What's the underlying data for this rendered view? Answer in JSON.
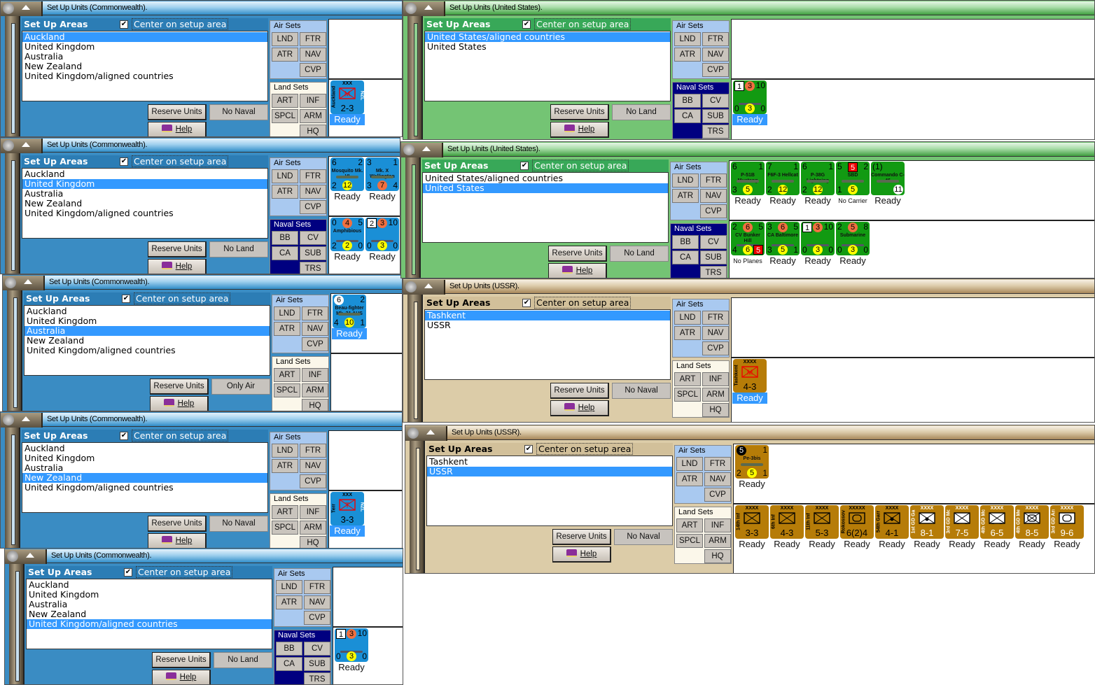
{
  "windows": [
    {
      "title": "Set Up Units (Commonwealth).",
      "header": "Set Up Areas",
      "center_label": "Center on setup area",
      "center_checked": true,
      "areas": [
        "Auckland",
        "United Kingdom",
        "Australia",
        "New Zealand",
        "United Kingdom/aligned countries"
      ],
      "selected_index": 0,
      "reserve_label": "Reserve Units",
      "filter_label": "No Naval",
      "help_label": "Help",
      "panels": [
        {
          "kind": "air",
          "title": "Air Sets",
          "buttons": [
            "LND",
            "FTR",
            "ATR",
            "NAV",
            "CVP"
          ],
          "counters": []
        },
        {
          "kind": "land",
          "title": "Land Sets",
          "buttons": [
            "ART",
            "INF",
            "SPCL",
            "ARM",
            "HQ"
          ],
          "counters": [
            {
              "type": "land",
              "echelon": "XXX",
              "name": "Auckland",
              "side": "NZL",
              "symbol": "M",
              "symbol_kind": "mountain",
              "strength": "2-3",
              "status": "Ready",
              "selected": true
            }
          ]
        }
      ]
    },
    {
      "title": "Set Up Units (Commonwealth).",
      "header": "Set Up Areas",
      "center_label": "Center on setup area",
      "center_checked": true,
      "areas": [
        "Auckland",
        "United Kingdom",
        "Australia",
        "New Zealand",
        "United Kingdom/aligned countries"
      ],
      "selected_index": 1,
      "reserve_label": "Reserve Units",
      "filter_label": "No Land",
      "help_label": "Help",
      "panels": [
        {
          "kind": "air",
          "title": "Air Sets",
          "buttons": [
            "LND",
            "FTR",
            "ATR",
            "NAV",
            "CVP"
          ],
          "counters": [
            {
              "type": "air",
              "tl": "6",
              "tr": "2",
              "name": "Mosquito Mk. VI",
              "bl": "2",
              "bc": {
                "v": "12",
                "c": "yellow"
              },
              "status": "Ready"
            },
            {
              "type": "air",
              "tl": "3",
              "tr": "1",
              "name": "Mk. X Wellington",
              "bc": {
                "v": "7",
                "c": "orange"
              },
              "bl": "3",
              "br": "4",
              "status": "Ready"
            }
          ]
        },
        {
          "kind": "naval",
          "title": "Naval Sets",
          "buttons": [
            "BB",
            "CV",
            "CA",
            "SUB",
            "TRS"
          ],
          "counters": [
            {
              "type": "naval",
              "tl": "0",
              "tc": {
                "v": "4",
                "c": "orange"
              },
              "tr": "5",
              "name": "Amphibious",
              "bl": "2",
              "bc": {
                "v": "2",
                "c": "yellow"
              },
              "br": "0",
              "status": "Ready"
            },
            {
              "type": "naval",
              "tl": {
                "v": "2",
                "c": "box"
              },
              "tc": {
                "v": "3",
                "c": "orange"
              },
              "tr": "10",
              "name": "",
              "bl": "0",
              "bc": {
                "v": "3",
                "c": "yellow"
              },
              "br": "0",
              "status": "Ready"
            }
          ]
        }
      ]
    },
    {
      "title": "Set Up Units (Commonwealth).",
      "header": "Set Up Areas",
      "center_label": "Center on setup area",
      "center_checked": true,
      "areas": [
        "Auckland",
        "United Kingdom",
        "Australia",
        "New Zealand",
        "United Kingdom/aligned countries"
      ],
      "selected_index": 2,
      "reserve_label": "Reserve Units",
      "filter_label": "Only Air",
      "help_label": "Help",
      "panels": [
        {
          "kind": "air",
          "title": "Air Sets",
          "buttons": [
            "LND",
            "FTR",
            "ATR",
            "NAV",
            "CVP"
          ],
          "counters": [
            {
              "type": "air",
              "tl": {
                "v": "6",
                "c": "white"
              },
              "tr": "2",
              "name": "Beau-fighter Mk. 21 AUS",
              "bl": "4",
              "bc": {
                "v": "10",
                "c": "yellow"
              },
              "br": "1",
              "status": "Ready",
              "selected": true
            }
          ]
        },
        {
          "kind": "land",
          "title": "Land Sets",
          "buttons": [
            "ART",
            "INF",
            "SPCL",
            "ARM",
            "HQ"
          ],
          "counters": []
        }
      ]
    },
    {
      "title": "Set Up Units (Commonwealth).",
      "header": "Set Up Areas",
      "center_label": "Center on setup area",
      "center_checked": true,
      "areas": [
        "Auckland",
        "United Kingdom",
        "Australia",
        "New Zealand",
        "United Kingdom/aligned countries"
      ],
      "selected_index": 3,
      "reserve_label": "Reserve Units",
      "filter_label": "No Naval",
      "help_label": "Help",
      "panels": [
        {
          "kind": "air",
          "title": "Air Sets",
          "buttons": [
            "LND",
            "FTR",
            "ATR",
            "NAV",
            "CVP"
          ],
          "counters": []
        },
        {
          "kind": "land",
          "title": "Land Sets",
          "buttons": [
            "ART",
            "INF",
            "SPCL",
            "ARM",
            "HQ"
          ],
          "counters": [
            {
              "type": "land",
              "echelon": "XXX",
              "name": "Terr",
              "side": "NZL",
              "symbol": "T",
              "symbol_kind": "mountain",
              "strength": "3-3",
              "status": "Ready",
              "selected": true
            }
          ]
        }
      ]
    },
    {
      "title": "Set Up Units (Commonwealth).",
      "header": "Set Up Areas",
      "center_label": "Center on setup area",
      "center_checked": true,
      "areas": [
        "Auckland",
        "United Kingdom",
        "Australia",
        "New Zealand",
        "United Kingdom/aligned countries"
      ],
      "selected_index": 4,
      "reserve_label": "Reserve Units",
      "filter_label": "No Land",
      "help_label": "Help",
      "panels": [
        {
          "kind": "air",
          "title": "Air Sets",
          "buttons": [
            "LND",
            "FTR",
            "ATR",
            "NAV",
            "CVP"
          ],
          "counters": []
        },
        {
          "kind": "naval",
          "title": "Naval Sets",
          "buttons": [
            "BB",
            "CV",
            "CA",
            "SUB",
            "TRS"
          ],
          "counters": [
            {
              "type": "naval",
              "tl": {
                "v": "1",
                "c": "box"
              },
              "tc": {
                "v": "3",
                "c": "orange"
              },
              "tr": "10",
              "name": "",
              "bl": "0",
              "bc": {
                "v": "3",
                "c": "yellow"
              },
              "br": "0",
              "status": "Ready"
            }
          ]
        }
      ]
    },
    {
      "title": "Set Up Units (United States).",
      "header": "Set Up Areas",
      "center_label": "Center on setup area",
      "center_checked": true,
      "areas": [
        "United States/aligned countries",
        "United States"
      ],
      "selected_index": 0,
      "reserve_label": "Reserve Units",
      "filter_label": "No Land",
      "help_label": "Help",
      "panels": [
        {
          "kind": "air",
          "title": "Air Sets",
          "buttons": [
            "LND",
            "FTR",
            "ATR",
            "NAV",
            "CVP"
          ],
          "counters": []
        },
        {
          "kind": "naval",
          "title": "Naval Sets",
          "buttons": [
            "BB",
            "CV",
            "CA",
            "SUB",
            "TRS"
          ],
          "counters": [
            {
              "type": "naval",
              "tl": {
                "v": "1",
                "c": "box"
              },
              "tc": {
                "v": "3",
                "c": "orange"
              },
              "tr": "10",
              "name": "",
              "bl": "0",
              "bc": {
                "v": "3",
                "c": "yellow"
              },
              "br": "0",
              "status": "Ready",
              "selected": true
            }
          ]
        }
      ]
    },
    {
      "title": "Set Up Units (United States).",
      "header": "Set Up Areas",
      "center_label": "Center on setup area",
      "center_checked": true,
      "areas": [
        "United States/aligned countries",
        "United States"
      ],
      "selected_index": 1,
      "reserve_label": "Reserve Units",
      "filter_label": "No Land",
      "help_label": "Help",
      "panels": [
        {
          "kind": "air",
          "title": "Air Sets",
          "buttons": [
            "LND",
            "FTR",
            "ATR",
            "NAV",
            "CVP"
          ],
          "counters": [
            {
              "type": "air",
              "tl": "6",
              "tr": "1",
              "name": "P-51B Mustang",
              "bl": "3",
              "bc": {
                "v": "5",
                "c": "yellow"
              },
              "status": "Ready"
            },
            {
              "type": "air",
              "tl": "7",
              "tr": "1",
              "name": "F6F-3 Hellcat",
              "bl": "2",
              "bc": {
                "v": "12",
                "c": "yellow"
              },
              "status": "Ready"
            },
            {
              "type": "air",
              "tl": "6",
              "tr": "1",
              "name": "P-38G Lightning",
              "bl": "2",
              "bc": {
                "v": "12",
                "c": "yellow"
              },
              "status": "Ready"
            },
            {
              "type": "air",
              "tl": "5",
              "tc": {
                "v": "5",
                "c": "red"
              },
              "tr": "2",
              "name": "SBD",
              "bl": "1",
              "bc": {
                "v": "5",
                "c": "yellow"
              },
              "status": "No Carrier"
            },
            {
              "type": "air",
              "tl": "(1)",
              "name": "Commando C-46",
              "br": {
                "v": "11",
                "c": "white"
              },
              "status": "Ready"
            }
          ]
        },
        {
          "kind": "naval",
          "title": "Naval Sets",
          "buttons": [
            "BB",
            "CV",
            "CA",
            "SUB",
            "TRS"
          ],
          "counters": [
            {
              "type": "naval",
              "tl": "2",
              "tc": {
                "v": "6",
                "c": "orange"
              },
              "tr": "5",
              "name": "CV Bunker Hill",
              "bl": "4",
              "bc": {
                "v": "6",
                "c": "yellow"
              },
              "br": {
                "v": "5",
                "c": "red"
              },
              "status": "No Planes"
            },
            {
              "type": "naval",
              "tl": "3",
              "tc": {
                "v": "6",
                "c": "orange"
              },
              "tr": "5",
              "name": "CA Baltimore",
              "bl": "3",
              "bc": {
                "v": "5",
                "c": "yellow"
              },
              "br": "1",
              "status": "Ready"
            },
            {
              "type": "naval",
              "tl": {
                "v": "1",
                "c": "box"
              },
              "tc": {
                "v": "3",
                "c": "orange"
              },
              "tr": "10",
              "name": "",
              "bl": "0",
              "bc": {
                "v": "3",
                "c": "yellow"
              },
              "br": "0",
              "status": "Ready"
            },
            {
              "type": "naval",
              "tl": "2",
              "tc": {
                "v": "5",
                "c": "orange"
              },
              "tr": "8",
              "name": "Submarine",
              "bl": "0",
              "bc": {
                "v": "3",
                "c": "yellow"
              },
              "br": "0",
              "status": "Ready"
            }
          ]
        }
      ]
    },
    {
      "title": "Set Up Units (USSR).",
      "header": "Set Up Areas",
      "center_label": "Center on setup area",
      "center_checked": true,
      "areas": [
        "Tashkent",
        "USSR"
      ],
      "selected_index": 0,
      "reserve_label": "Reserve Units",
      "filter_label": "No Naval",
      "help_label": "Help",
      "panels": [
        {
          "kind": "air",
          "title": "Air Sets",
          "buttons": [
            "LND",
            "FTR",
            "ATR",
            "NAV",
            "CVP"
          ],
          "counters": []
        },
        {
          "kind": "land",
          "title": "Land Sets",
          "buttons": [
            "ART",
            "INF",
            "SPCL",
            "ARM",
            "HQ"
          ],
          "counters": [
            {
              "type": "land",
              "echelon": "XXXX",
              "name": "Tashkent",
              "symbol": "M",
              "symbol_kind": "mountain",
              "strength": "4-3",
              "status": "Ready",
              "selected": true
            }
          ]
        }
      ]
    },
    {
      "title": "Set Up Units (USSR).",
      "header": "Set Up Areas",
      "center_label": "Center on setup area",
      "center_checked": true,
      "areas": [
        "Tashkent",
        "USSR"
      ],
      "selected_index": 1,
      "reserve_label": "Reserve Units",
      "filter_label": "No Naval",
      "help_label": "Help",
      "panels": [
        {
          "kind": "air",
          "title": "Air Sets",
          "buttons": [
            "LND",
            "FTR",
            "ATR",
            "NAV",
            "CVP"
          ],
          "counters": [
            {
              "type": "air",
              "tl": {
                "v": "5",
                "c": "black"
              },
              "tr": "1",
              "name": "Pe-3bis",
              "bl": "2",
              "bc": {
                "v": "5",
                "c": "yellow"
              },
              "br": "1",
              "status": "Ready"
            }
          ]
        },
        {
          "kind": "land",
          "title": "Land Sets",
          "buttons": [
            "ART",
            "INF",
            "SPCL",
            "ARM",
            "HQ"
          ],
          "counters": [
            {
              "type": "land",
              "echelon": "XXXX",
              "name": "14th Inf",
              "symbol_kind": "inf",
              "strength": "3-3",
              "status": "Ready"
            },
            {
              "type": "land",
              "echelon": "XXXX",
              "name": "6th Inf",
              "symbol_kind": "inf",
              "strength": "4-3",
              "status": "Ready"
            },
            {
              "type": "land",
              "echelon": "XXXX",
              "name": "11th Inf",
              "symbol_kind": "inf",
              "strength": "5-3",
              "status": "Ready"
            },
            {
              "type": "land",
              "echelon": "XXXXX",
              "name": "Rokossovs.",
              "symbol_kind": "armor",
              "strength": "6(2)4",
              "status": "Ready"
            },
            {
              "type": "land",
              "echelon": "XXXX",
              "name": "54th Garr",
              "symbol_kind": "garr",
              "strength": "4-1",
              "status": "Ready"
            },
            {
              "type": "land",
              "echelon": "XXXX",
              "name": "1st GD Garr",
              "symbol_kind": "garr",
              "guards": true,
              "strength": "8-1",
              "status": "Ready"
            },
            {
              "type": "land",
              "echelon": "XXXX",
              "name": "3rd GD Mot",
              "symbol_kind": "mot",
              "guards": true,
              "strength": "7-5",
              "status": "Ready"
            },
            {
              "type": "land",
              "echelon": "XXXX",
              "name": "4th GD Mot",
              "symbol_kind": "mot",
              "guards": true,
              "strength": "6-5",
              "status": "Ready"
            },
            {
              "type": "land",
              "echelon": "XXXX",
              "name": "4th GD Me.",
              "symbol_kind": "mech",
              "guards": true,
              "strength": "8-5",
              "status": "Ready"
            },
            {
              "type": "land",
              "echelon": "XXXX",
              "name": "3rd GD Arm",
              "symbol_kind": "armor",
              "guards": true,
              "strength": "9-6",
              "status": "Ready"
            }
          ]
        }
      ]
    }
  ]
}
